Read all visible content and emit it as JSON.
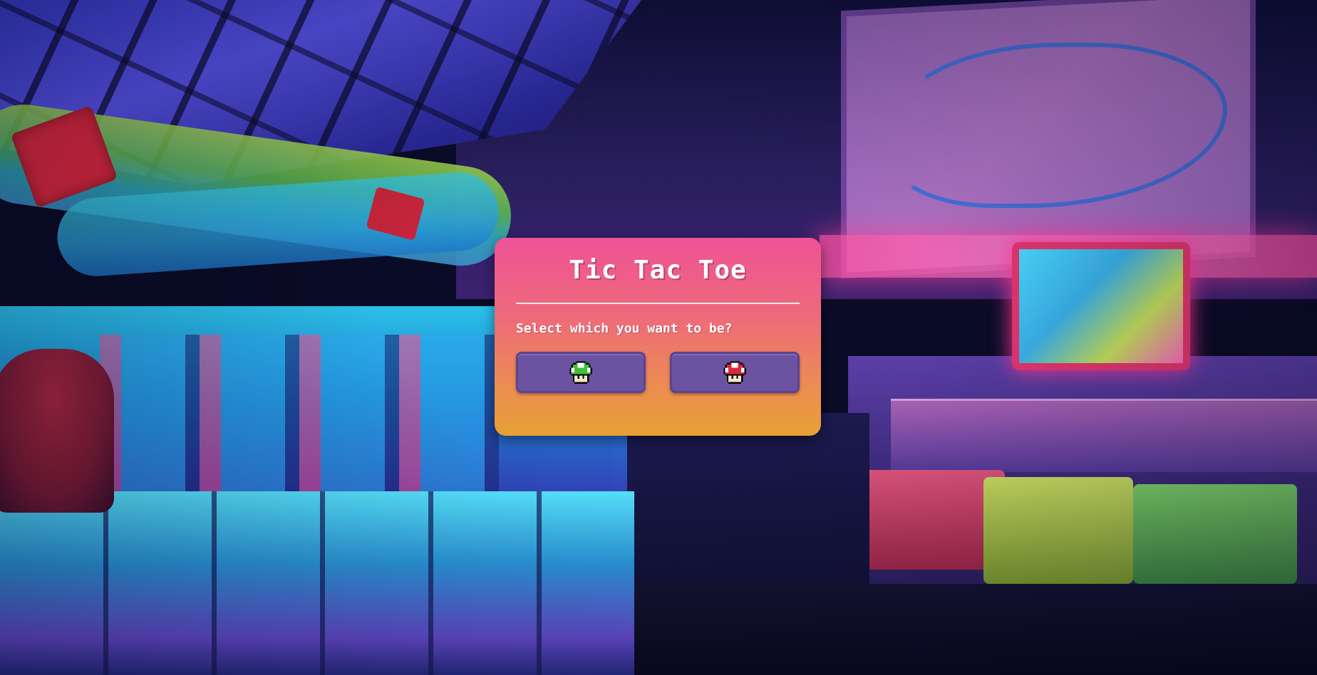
{
  "modal": {
    "title": "Tic Tac Toe",
    "prompt": "Select which you want to be?",
    "choices": [
      {
        "icon": "green-mushroom-icon",
        "color": "#3fbf3f"
      },
      {
        "icon": "red-mushroom-icon",
        "color": "#d8283e"
      }
    ]
  },
  "colors": {
    "modal_gradient_top": "#ee5396",
    "modal_gradient_bottom": "#e7a034",
    "button": "#6b53a1"
  }
}
